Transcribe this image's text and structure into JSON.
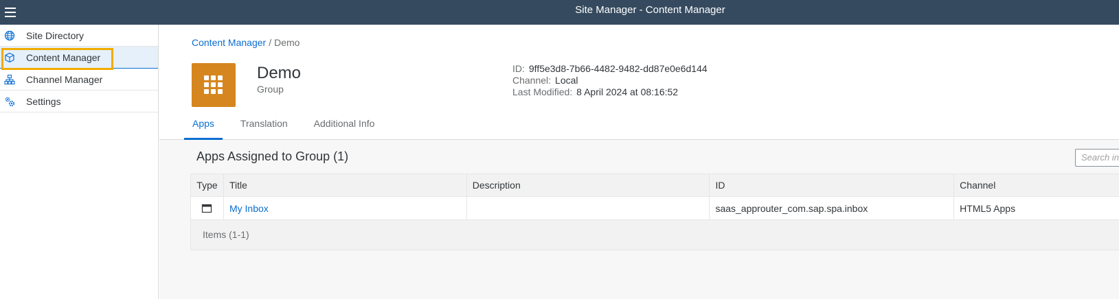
{
  "shell": {
    "title": "Site Manager - Content Manager",
    "menu_icon": "hamburger-menu-icon"
  },
  "sidebar": {
    "items": [
      {
        "label": "Site Directory",
        "icon": "globe-icon",
        "selected": false
      },
      {
        "label": "Content Manager",
        "icon": "cube-icon",
        "selected": true
      },
      {
        "label": "Channel Manager",
        "icon": "hierarchy-icon",
        "selected": false
      },
      {
        "label": "Settings",
        "icon": "gears-icon",
        "selected": false
      }
    ]
  },
  "breadcrumb": {
    "link": "Content Manager",
    "separator": "/",
    "current": "Demo"
  },
  "object": {
    "title": "Demo",
    "subtitle": "Group",
    "icon": "app-grid-icon",
    "icon_color": "#d6861e",
    "attributes": [
      {
        "key": "ID:",
        "value": "9ff5e3d8-7b66-4482-9482-dd87e0e6d144"
      },
      {
        "key": "Channel:",
        "value": "Local"
      },
      {
        "key": "Last Modified:",
        "value": "8 April 2024 at 08:16:52"
      }
    ]
  },
  "tabs": [
    {
      "label": "Apps",
      "active": true
    },
    {
      "label": "Translation",
      "active": false
    },
    {
      "label": "Additional Info",
      "active": false
    }
  ],
  "apps_table": {
    "title": "Apps Assigned to Group (1)",
    "search_placeholder": "Search in",
    "columns": [
      "Type",
      "Title",
      "Description",
      "ID",
      "Channel"
    ],
    "rows": [
      {
        "type_icon": "app-window-icon",
        "title": "My Inbox",
        "description": "",
        "id": "saas_approuter_com.sap.spa.inbox",
        "channel": "HTML5 Apps"
      }
    ],
    "footer": "Items (1-1)"
  },
  "colors": {
    "shell_bg": "#354a5f",
    "accent": "#0a6ed1",
    "highlight_border": "#f0ab00"
  }
}
